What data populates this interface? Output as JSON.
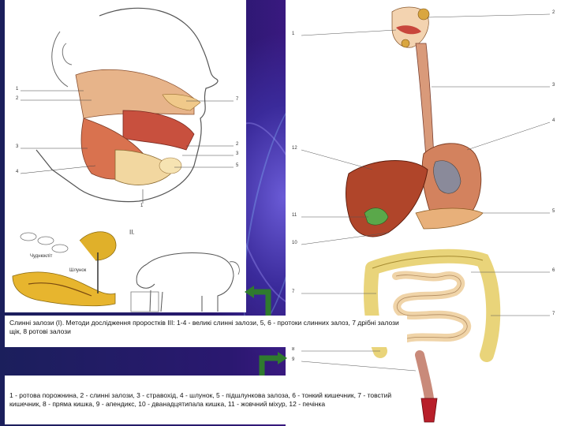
{
  "figure_number": "II.",
  "caption_top": "Слинні залози (І). Методи дослідження проростків III: 1-4 - великі слинні залози, 5, 6 - протоки слинних залоз, 7 дрібні залози щік, 8 ротові залози",
  "caption_bottom": "1 - ротова порожнина, 2 - слинні залози, 3 - стравохід, 4 - шлунок, 5 - підшлункова залоза, 6 - тонкий кишечник, 7 - товстий кишечник, 8 - пряма кишка, 9 - апендикс, 10 - дванадцятипала кишка, 11 - жовчний міхур, 12 - печінка",
  "dog_labels": [
    "Чуднюкліт",
    "Шлунок"
  ],
  "left_leaders": [
    "1",
    "2",
    "3",
    "4"
  ],
  "left_right_leaders": [
    "7",
    "2",
    "3",
    "5"
  ],
  "left_bottom_leader": "1",
  "right_left_leaders": [
    "1",
    "12",
    "11",
    "10",
    "7",
    "8",
    "9"
  ],
  "right_right_leaders": [
    "2",
    "3",
    "4",
    "5",
    "6",
    "7"
  ],
  "colors": {
    "background": "#1a1240",
    "arrow": "#2f7a2e",
    "liver": "#b0452a",
    "intestine": "#e9d47a",
    "stomach": "#d3825e"
  }
}
